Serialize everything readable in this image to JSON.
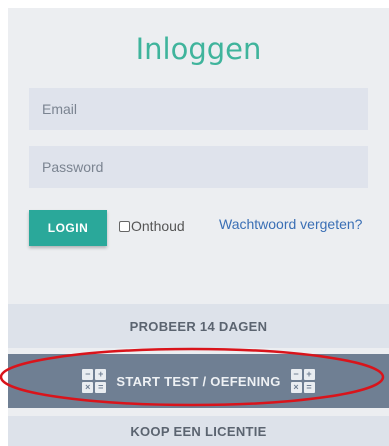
{
  "login": {
    "title": "Inloggen",
    "email_placeholder": "Email",
    "password_placeholder": "Password",
    "login_label": "LOGIN",
    "remember_label": "Onthoud",
    "forgot_label": "Wachtwoord vergeten?"
  },
  "actions": {
    "trial_label": "PROBEER 14 DAGEN",
    "start_label": "START TEST / OEFENING",
    "buy_label": "KOOP EEN LICENTIE"
  },
  "colors": {
    "accent": "#2aa89a",
    "title": "#3fb49c",
    "link": "#3a6fb5",
    "highlight_ring": "#d9141b"
  },
  "icons": {
    "calculator_left": "calculator-icon",
    "calculator_right": "calculator-icon"
  }
}
